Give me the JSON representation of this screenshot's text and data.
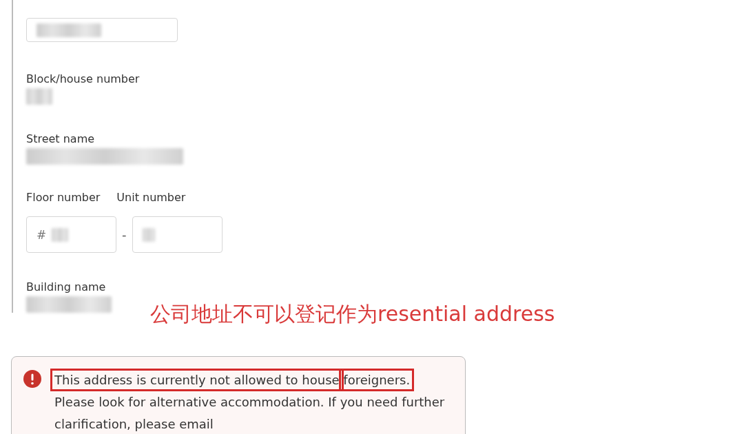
{
  "fields": [
    {
      "kind": "box"
    },
    {
      "kind": "text",
      "label": "Block/house number"
    },
    {
      "kind": "text",
      "label": "Street name"
    },
    {
      "kind": "pair",
      "items": [
        {
          "label": "Floor number",
          "prefix": "#"
        },
        {
          "label": "Unit number"
        }
      ],
      "separator": "-"
    },
    {
      "kind": "text",
      "label": "Building name"
    }
  ],
  "annotation": "公司地址不可以登记作为resential address",
  "alert": {
    "segments": [
      {
        "text": "This address is currently not allowed to house",
        "highlighted": true
      },
      {
        "text": "foreigners.",
        "highlighted": true
      },
      {
        "text": "Please look for alternative accommodation. If you need further clarification, please email",
        "highlighted": false
      }
    ]
  }
}
